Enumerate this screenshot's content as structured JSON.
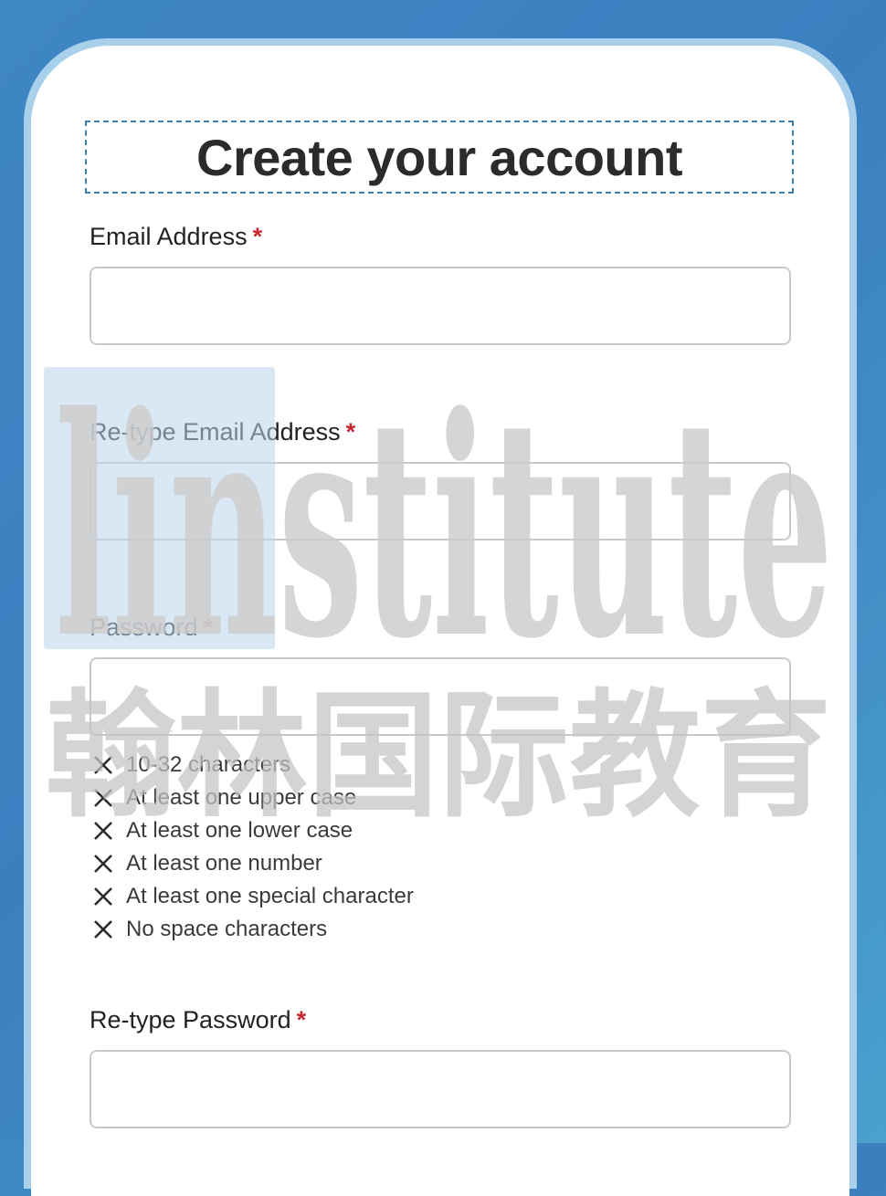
{
  "form": {
    "title": "Create your account",
    "required_marker": "*",
    "fields": [
      {
        "label": "Email Address",
        "value": "",
        "placeholder": ""
      },
      {
        "label": "Re-type Email Address",
        "value": "",
        "placeholder": ""
      },
      {
        "label": "Password",
        "value": "",
        "placeholder": ""
      },
      {
        "label": "Re-type Password",
        "value": "",
        "placeholder": ""
      }
    ],
    "password_rules": [
      {
        "text": "10-32 characters",
        "icon": "x-icon",
        "met": false
      },
      {
        "text": "At least one upper case",
        "icon": "x-icon",
        "met": false
      },
      {
        "text": "At least one lower case",
        "icon": "x-icon",
        "met": false
      },
      {
        "text": "At least one number",
        "icon": "x-icon",
        "met": false
      },
      {
        "text": "At least one special character",
        "icon": "x-icon",
        "met": false
      },
      {
        "text": "No space characters",
        "icon": "x-icon",
        "met": false
      }
    ]
  },
  "watermark": {
    "text": "linstitute",
    "subtext": "翰林国际教育"
  },
  "colors": {
    "required": "#c8252c",
    "title_border": "#3a80b4",
    "background": "#3f86c4"
  }
}
